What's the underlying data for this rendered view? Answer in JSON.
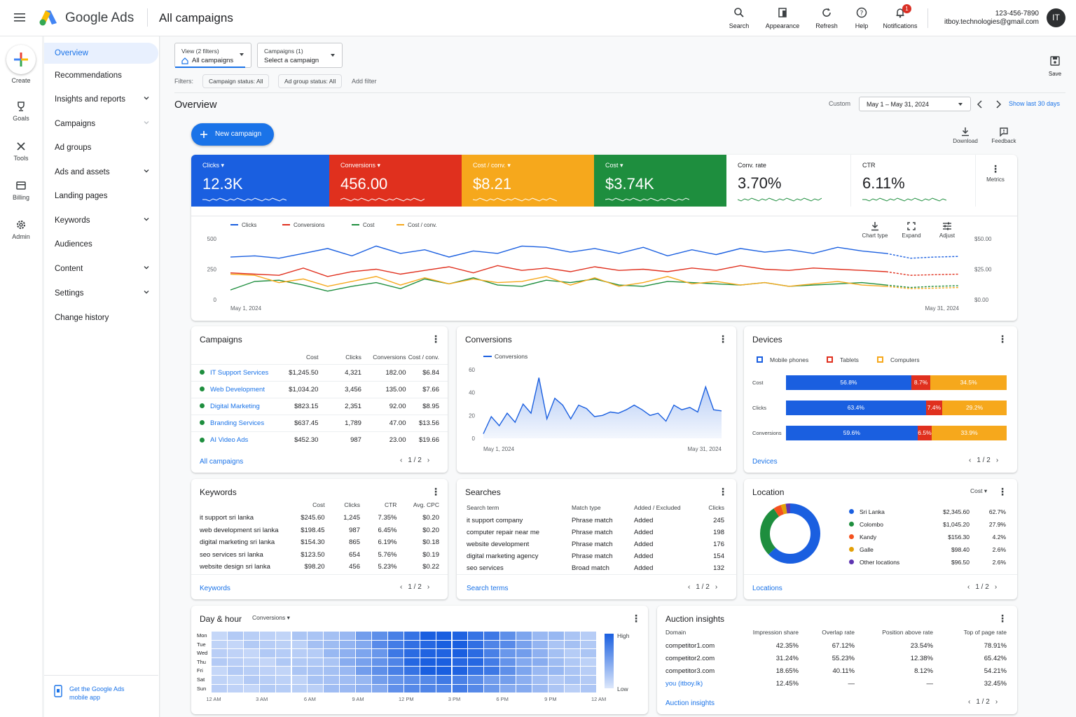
{
  "topbar": {
    "app_name": "Google Ads",
    "page_title": "All campaigns",
    "actions": [
      {
        "label": "Search",
        "icon": "search-icon"
      },
      {
        "label": "Appearance",
        "icon": "appearance-icon"
      },
      {
        "label": "Refresh",
        "icon": "refresh-icon"
      },
      {
        "label": "Help",
        "icon": "help-icon"
      },
      {
        "label": "Notifications",
        "icon": "bell-icon"
      }
    ],
    "notification_count": "1",
    "phone": "123-456-7890",
    "email": "itboy.technologies@gmail.com",
    "avatar": "IT"
  },
  "rail": {
    "create": "Create",
    "items": [
      {
        "label": "Goals",
        "icon": "trophy-icon"
      },
      {
        "label": "Tools",
        "icon": "tools-icon"
      },
      {
        "label": "Billing",
        "icon": "billing-icon"
      },
      {
        "label": "Admin",
        "icon": "admin-gear-icon"
      }
    ]
  },
  "nav": {
    "items": [
      {
        "label": "Overview",
        "active": true,
        "chevron": false
      },
      {
        "label": "Recommendations",
        "chevron": false
      },
      {
        "label": "Insights and reports",
        "chevron": true
      },
      {
        "label": "Campaigns",
        "chevron": true
      },
      {
        "label": "Ad groups",
        "chevron": false
      },
      {
        "label": "Ads and assets",
        "chevron": true
      },
      {
        "label": "Landing pages",
        "chevron": false
      },
      {
        "label": "Keywords",
        "chevron": true
      },
      {
        "label": "Audiences",
        "chevron": false
      },
      {
        "label": "Content",
        "chevron": true
      },
      {
        "label": "Settings",
        "chevron": true
      },
      {
        "label": "Change history",
        "chevron": false
      }
    ],
    "get_app": "Get the Google Ads mobile app"
  },
  "toolbar": {
    "view_label": "View (2 filters)",
    "view_value": "All campaigns",
    "campaigns_label": "Campaigns (1)",
    "campaigns_value": "Select a campaign",
    "save": "Save",
    "filters_label": "Filters:",
    "filters": [
      "Campaign status: All",
      "Ad group status: All"
    ],
    "add_filter": "Add filter"
  },
  "overview": {
    "title": "Overview",
    "custom": "Custom",
    "date_range": "May 1 – May 31, 2024",
    "show_last": "Show last 30 days",
    "new_campaign": "New campaign",
    "download": "Download",
    "feedback": "Feedback"
  },
  "metrics": [
    {
      "label": "Clicks",
      "value": "12.3K",
      "color": "#1a5fe0",
      "dropdown": true
    },
    {
      "label": "Conversions",
      "value": "456.00",
      "color": "#e0301e",
      "dropdown": true
    },
    {
      "label": "Cost / conv.",
      "value": "$8.21",
      "color": "#f6a81c",
      "dropdown": true
    },
    {
      "label": "Cost",
      "value": "$3.74K",
      "color": "#1e8e3e",
      "dropdown": true
    },
    {
      "label": "Conv. rate",
      "value": "3.70%",
      "color": "#ffffff",
      "dropdown": false
    },
    {
      "label": "CTR",
      "value": "6.11%",
      "color": "#ffffff",
      "dropdown": false
    }
  ],
  "metrics_button": "Metrics",
  "main_chart": {
    "legend": [
      "Clicks",
      "Conversions",
      "Cost",
      "Cost / conv."
    ],
    "colors": [
      "#1a5fe0",
      "#e0301e",
      "#1e8e3e",
      "#f6a81c"
    ],
    "y_left": [
      "500",
      "250",
      "0"
    ],
    "y_right": [
      "$50.00",
      "$25.00",
      "$0.00"
    ],
    "x_start": "May 1, 2024",
    "x_end": "May 31, 2024",
    "actions": [
      "Chart type",
      "Expand",
      "Adjust"
    ]
  },
  "chart_data": [
    {
      "type": "line",
      "x_labels": [
        "May 1, 2024",
        "May 31, 2024"
      ],
      "y_left_range": [
        0,
        500
      ],
      "y_right_range": [
        0,
        50
      ],
      "series": [
        {
          "name": "Clicks",
          "values": [
            350,
            360,
            340,
            380,
            420,
            360,
            440,
            380,
            410,
            350,
            400,
            380,
            440,
            430,
            390,
            420,
            380,
            430,
            360,
            410,
            370,
            420,
            390,
            410,
            380,
            430,
            400,
            380,
            340,
            350,
            355
          ]
        },
        {
          "name": "Conversions",
          "values": [
            220,
            210,
            200,
            260,
            190,
            230,
            250,
            210,
            240,
            270,
            220,
            280,
            240,
            260,
            230,
            270,
            240,
            250,
            230,
            260,
            240,
            280,
            250,
            240,
            260,
            250,
            240,
            230,
            200,
            205,
            210
          ]
        },
        {
          "name": "Cost",
          "values": [
            80,
            150,
            160,
            120,
            70,
            110,
            140,
            90,
            170,
            130,
            180,
            120,
            110,
            160,
            140,
            170,
            120,
            110,
            150,
            140,
            130,
            120,
            140,
            110,
            120,
            130,
            140,
            120,
            100,
            110,
            115
          ]
        },
        {
          "name": "Cost / conv.",
          "values": [
            210,
            200,
            140,
            170,
            110,
            150,
            190,
            120,
            180,
            130,
            170,
            140,
            150,
            190,
            120,
            180,
            110,
            140,
            190,
            130,
            150,
            120,
            140,
            110,
            130,
            150,
            120,
            110,
            90,
            95,
            100
          ]
        }
      ]
    },
    {
      "type": "area",
      "series": [
        {
          "name": "Conversions",
          "values": [
            4,
            19,
            11,
            22,
            14,
            30,
            22,
            53,
            17,
            35,
            29,
            17,
            29,
            26,
            19,
            20,
            23,
            22,
            25,
            29,
            25,
            20,
            22,
            15,
            29,
            25,
            27,
            23,
            45,
            25,
            24
          ]
        }
      ],
      "y_ticks": [
        "60",
        "40",
        "20",
        "0"
      ],
      "ylim": [
        0,
        60
      ],
      "x_labels": [
        "May 1, 2024",
        "May 31, 2024"
      ]
    },
    {
      "type": "bar",
      "categories": [
        "Cost",
        "Clicks",
        "Conversions"
      ],
      "series": [
        {
          "name": "Mobile phones",
          "values": [
            56.8,
            63.4,
            59.6
          ]
        },
        {
          "name": "Tablets",
          "values": [
            8.7,
            7.4,
            6.5
          ]
        },
        {
          "name": "Computers",
          "values": [
            34.5,
            29.2,
            33.9
          ]
        }
      ]
    },
    {
      "type": "pie",
      "categories": [
        "Sri Lanka",
        "Colombo",
        "Kandy",
        "Galle",
        "Other locations"
      ],
      "values": [
        62.7,
        27.9,
        4.2,
        2.6,
        2.6
      ]
    }
  ],
  "campaigns": {
    "title": "Campaigns",
    "columns": [
      "Cost",
      "Clicks",
      "Conversions",
      "Cost / conv."
    ],
    "rows": [
      {
        "name": "IT Support Services",
        "cost": "$1,245.50",
        "clicks": "4,321",
        "conv": "182.00",
        "cpc": "$6.84"
      },
      {
        "name": "Web Development",
        "cost": "$1,034.20",
        "clicks": "3,456",
        "conv": "135.00",
        "cpc": "$7.66"
      },
      {
        "name": "Digital Marketing",
        "cost": "$823.15",
        "clicks": "2,351",
        "conv": "92.00",
        "cpc": "$8.95"
      },
      {
        "name": "Branding Services",
        "cost": "$637.45",
        "clicks": "1,789",
        "conv": "47.00",
        "cpc": "$13.56"
      },
      {
        "name": "AI Video Ads",
        "cost": "$452.30",
        "clicks": "987",
        "conv": "23.00",
        "cpc": "$19.66"
      }
    ],
    "link": "All campaigns",
    "pager": "1 / 2"
  },
  "conversions_card": {
    "title": "Conversions",
    "legend": "Conversions",
    "x_start": "May 1, 2024",
    "x_end": "May 31, 2024"
  },
  "devices": {
    "title": "Devices",
    "legend": [
      "Mobile phones",
      "Tablets",
      "Computers"
    ],
    "colors": [
      "#1a5fe0",
      "#e0301e",
      "#f6a81c"
    ],
    "rows": [
      {
        "label": "Cost",
        "vals": [
          "56.8%",
          "8.7%",
          "34.5%"
        ]
      },
      {
        "label": "Clicks",
        "vals": [
          "63.4%",
          "7.4%",
          "29.2%"
        ]
      },
      {
        "label": "Conversions",
        "vals": [
          "59.6%",
          "6.5%",
          "33.9%"
        ]
      }
    ],
    "link": "Devices",
    "pager": "1 / 2"
  },
  "keywords": {
    "title": "Keywords",
    "columns": [
      "Cost",
      "Clicks",
      "CTR",
      "Avg. CPC"
    ],
    "rows": [
      {
        "kw": "it support sri lanka",
        "cost": "$245.60",
        "clicks": "1,245",
        "ctr": "7.35%",
        "cpc": "$0.20"
      },
      {
        "kw": "web development sri lanka",
        "cost": "$198.45",
        "clicks": "987",
        "ctr": "6.45%",
        "cpc": "$0.20"
      },
      {
        "kw": "digital marketing sri lanka",
        "cost": "$154.30",
        "clicks": "865",
        "ctr": "6.19%",
        "cpc": "$0.18"
      },
      {
        "kw": "seo services sri lanka",
        "cost": "$123.50",
        "clicks": "654",
        "ctr": "5.76%",
        "cpc": "$0.19"
      },
      {
        "kw": "website design sri lanka",
        "cost": "$98.20",
        "clicks": "456",
        "ctr": "5.23%",
        "cpc": "$0.22"
      }
    ],
    "link": "Keywords",
    "pager": "1 / 2"
  },
  "searches": {
    "title": "Searches",
    "columns": [
      "Search term",
      "Match type",
      "Added / Excluded",
      "Clicks"
    ],
    "rows": [
      {
        "term": "it support company",
        "match": "Phrase match",
        "added": "Added",
        "clicks": "245"
      },
      {
        "term": "computer repair near me",
        "match": "Phrase match",
        "added": "Added",
        "clicks": "198"
      },
      {
        "term": "website development",
        "match": "Phrase match",
        "added": "Added",
        "clicks": "176"
      },
      {
        "term": "digital marketing agency",
        "match": "Phrase match",
        "added": "Added",
        "clicks": "154"
      },
      {
        "term": "seo services",
        "match": "Broad match",
        "added": "Added",
        "clicks": "132"
      }
    ],
    "link": "Search terms",
    "pager": "1 / 2"
  },
  "location": {
    "title": "Location",
    "metric": "Cost",
    "rows": [
      {
        "name": "Sri Lanka",
        "value": "$2,345.60",
        "pct": "62.7%",
        "color": "#1a5fe0"
      },
      {
        "name": "Colombo",
        "value": "$1,045.20",
        "pct": "27.9%",
        "color": "#1e8e3e"
      },
      {
        "name": "Kandy",
        "value": "$156.30",
        "pct": "4.2%",
        "color": "#f4511e"
      },
      {
        "name": "Galle",
        "value": "$98.40",
        "pct": "2.6%",
        "color": "#e3a008"
      },
      {
        "name": "Other locations",
        "value": "$96.50",
        "pct": "2.6%",
        "color": "#5e35b1"
      }
    ],
    "link": "Locations",
    "pager": "1 / 2"
  },
  "dayhour": {
    "title": "Day & hour",
    "metric": "Conversions",
    "days": [
      "Mon",
      "Tue",
      "Wed",
      "Thu",
      "Fri",
      "Sat",
      "Sun"
    ],
    "hours": [
      "12 AM",
      "3 AM",
      "6 AM",
      "9 AM",
      "12 PM",
      "3 PM",
      "6 PM",
      "9 PM",
      "12 AM"
    ],
    "scale_high": "High",
    "scale_low": "Low"
  },
  "auction": {
    "title": "Auction insights",
    "columns": [
      "Domain",
      "Impression share",
      "Overlap rate",
      "Position above rate",
      "Top of page rate"
    ],
    "rows": [
      {
        "domain": "competitor1.com",
        "is": "42.35%",
        "ov": "67.12%",
        "pa": "23.54%",
        "top": "78.91%"
      },
      {
        "domain": "competitor2.com",
        "is": "31.24%",
        "ov": "55.23%",
        "pa": "12.38%",
        "top": "65.42%"
      },
      {
        "domain": "competitor3.com",
        "is": "18.65%",
        "ov": "40.11%",
        "pa": "8.12%",
        "top": "54.21%"
      },
      {
        "domain": "you (itboy.lk)",
        "is": "12.45%",
        "ov": "—",
        "pa": "—",
        "top": "32.45%"
      }
    ],
    "link": "Auction insights",
    "pager": "1 / 2"
  }
}
